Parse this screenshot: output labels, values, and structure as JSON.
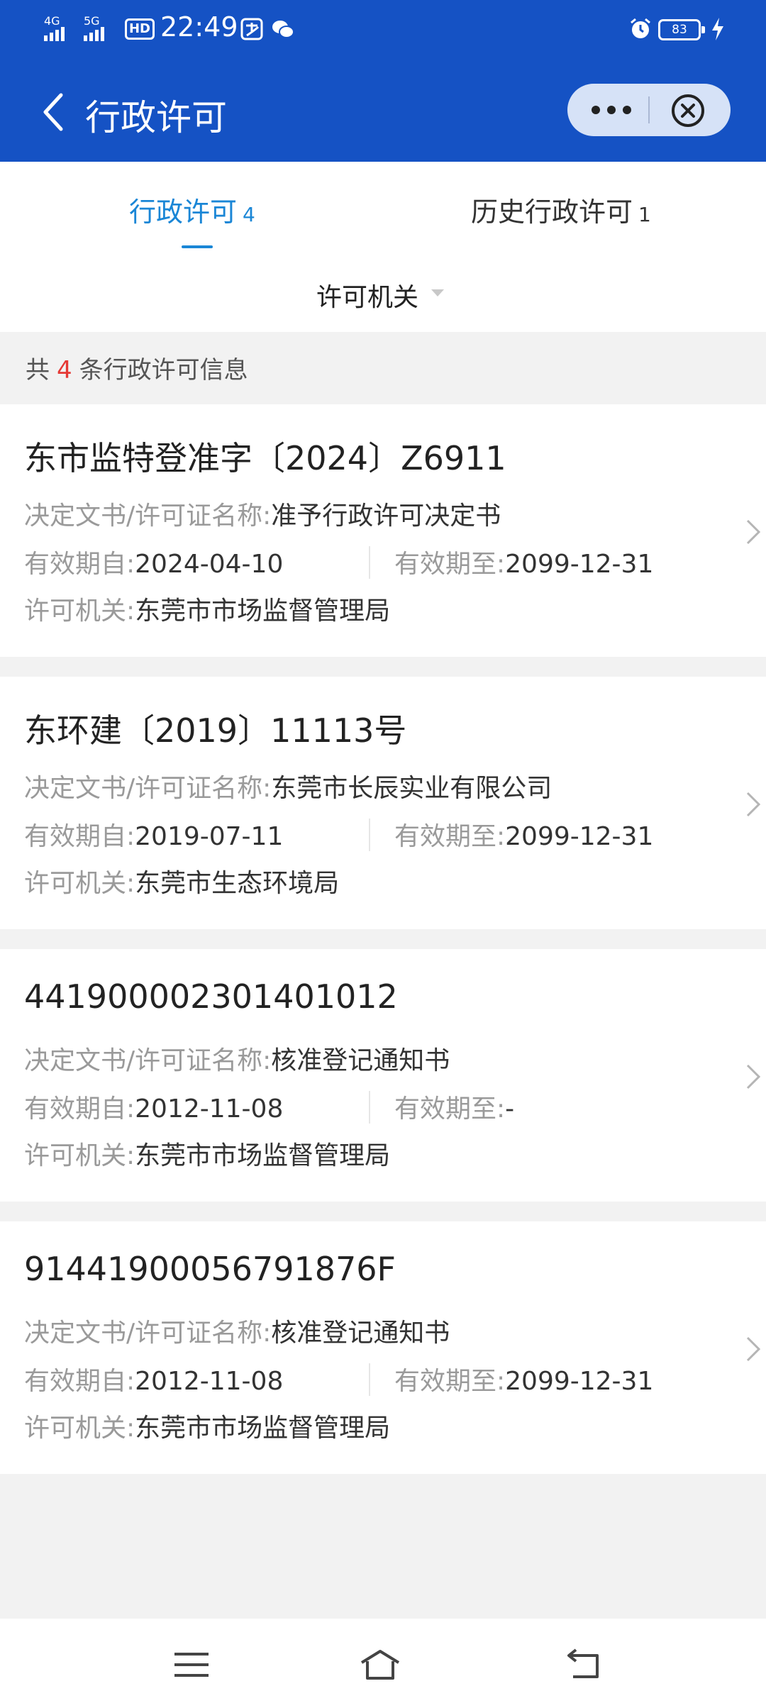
{
  "status_bar": {
    "signal_1": "4G",
    "signal_2": "5G",
    "hd_badge": "HD",
    "time": "22:49",
    "battery": "83",
    "icons": [
      "alipay-icon",
      "wechat-icon",
      "alarm-icon",
      "charging-icon"
    ]
  },
  "header": {
    "title": "行政许可",
    "more_icon": "more-dots-icon",
    "close_icon": "close-circle-icon",
    "bg_color": "#1552c4"
  },
  "tabs": [
    {
      "label": "行政许可",
      "count": "4",
      "active": true
    },
    {
      "label": "历史行政许可",
      "count": "1",
      "active": false
    }
  ],
  "filter": {
    "label": "许可机关"
  },
  "summary": {
    "prefix": "共",
    "count": "4",
    "suffix": "条行政许可信息"
  },
  "labels": {
    "doc_name": "决定文书/许可证名称:",
    "valid_from": "有效期自:",
    "valid_to": "有效期至:",
    "authority": "许可机关:"
  },
  "records": [
    {
      "title": "东市监特登准字〔2024〕Z6911",
      "doc_name": "准予行政许可决定书",
      "valid_from": "2024-04-10",
      "valid_to": "2099-12-31",
      "authority": "东莞市市场监督管理局"
    },
    {
      "title": "东环建〔2019〕11113号",
      "doc_name": "东莞市长辰实业有限公司",
      "valid_from": "2019-07-11",
      "valid_to": "2099-12-31",
      "authority": "东莞市生态环境局"
    },
    {
      "title": "441900002301401012",
      "doc_name": "核准登记通知书",
      "valid_from": "2012-11-08",
      "valid_to": "-",
      "authority": "东莞市市场监督管理局"
    },
    {
      "title": "91441900056791876F",
      "doc_name": "核准登记通知书",
      "valid_from": "2012-11-08",
      "valid_to": "2099-12-31",
      "authority": "东莞市市场监督管理局"
    }
  ],
  "colors": {
    "accent": "#1a86d6",
    "count_red": "#e53935",
    "header_blue": "#1552c4"
  },
  "system_nav": [
    "menu-icon",
    "home-icon",
    "back-icon"
  ]
}
